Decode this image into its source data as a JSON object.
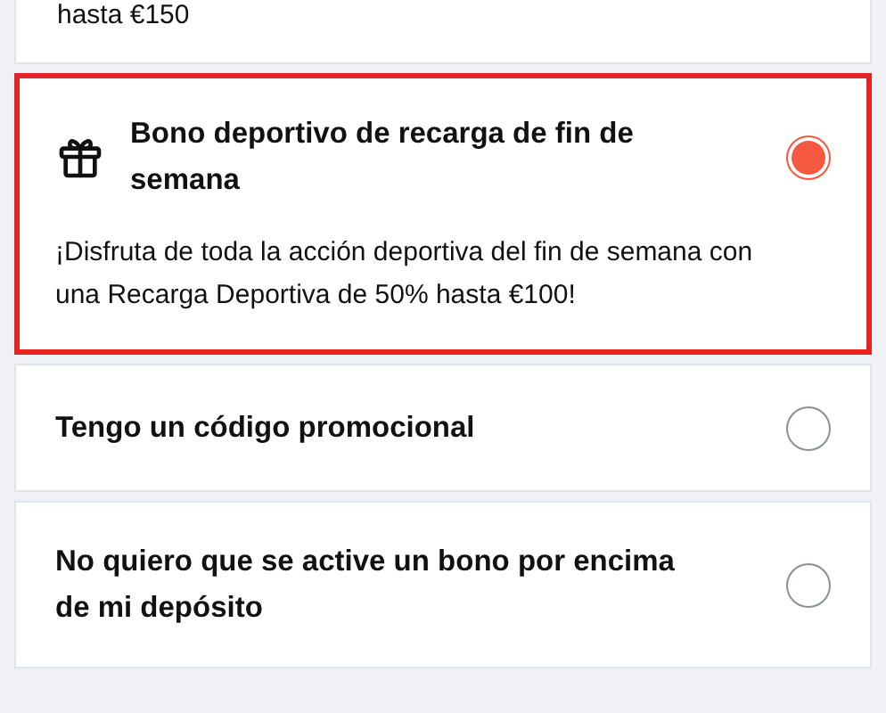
{
  "top_fragment": {
    "text": "hasta €150"
  },
  "offers": [
    {
      "kind": "featured",
      "title": "Bono deportivo de recarga de fin de semana",
      "description": "¡Disfruta de toda la acción deportiva del fin de semana con una Recarga Deportiva de 50% hasta €100!",
      "selected": true
    },
    {
      "kind": "plain",
      "title": "Tengo un código promocional",
      "selected": false
    },
    {
      "kind": "plain",
      "title": "No quiero que se active un bono por encima de mi depósito",
      "selected": false
    }
  ]
}
